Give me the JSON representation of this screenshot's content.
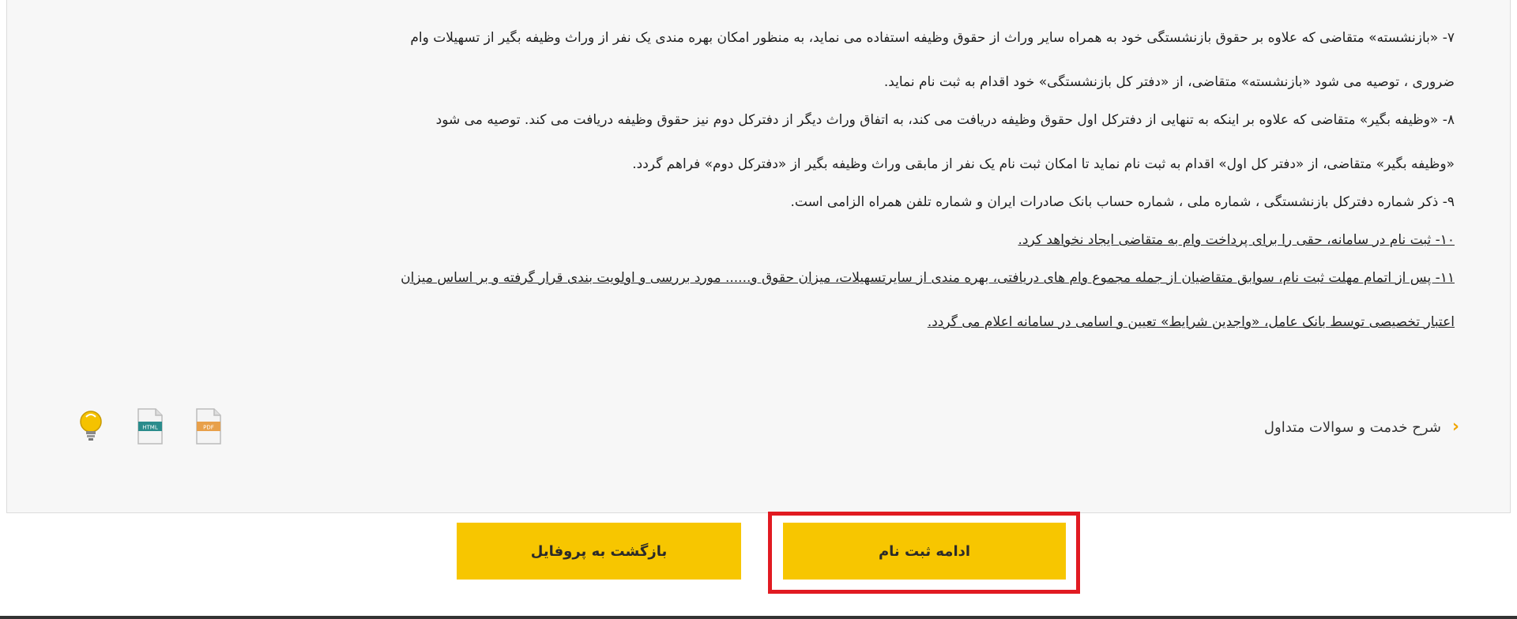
{
  "rules": {
    "r7_line1": "۷- «بازنشسته» متقاضی که علاوه بر حقوق بازنشستگی خود به همراه سایر وراث از حقوق وظیفه استفاده می نماید، به منظور امکان بهره مندی یک نفر از وراث وظیفه بگیر از تسهیلات وام",
    "r7_line2": "ضروری ، توصیه می شود «بازنشسته» متقاضی، از «دفتر کل بازنشستگی» خود اقدام به ثبت نام نماید.",
    "r8_line1": "۸- «وظیفه بگیر» متقاضی که علاوه بر اینکه به تنهایی از دفترکل اول حقوق وظیفه دریافت می کند، به اتفاق وراث دیگر از دفترکل دوم نیز حقوق وظیفه دریافت می کند. توصیه می شود",
    "r8_line2": "«وظیفه بگیر» متقاضی، از «دفتر کل اول» اقدام به ثبت نام نماید تا امکان ثبت نام یک نفر از مابقی وراث وظیفه بگیر از «دفترکل دوم» فراهم گردد.",
    "r9": "۹- ذکر شماره دفترکل بازنشستگی ، شماره ملی ، شماره حساب بانک صادرات ایران و شماره تلفن همراه الزامی است.",
    "r10": "۱۰- ثبت نام در سامانه، حقی را برای پرداخت وام به متقاضی ایجاد نخواهد کرد.",
    "r11_line1": "۱۱- پس از اتمام مهلت ثبت نام، سوابق متقاضیان از جمله مجموع وام های دریافتی، بهره مندی از سایرتسهیلات، میزان حقوق و...... مورد بررسی و اولویت بندی قرار گرفته و بر اساس میزان",
    "r11_line2": "اعتبار تخصیصی توسط بانک عامل، «واجدین شرایط» تعیین و اسامی در سامانه اعلام می گردد."
  },
  "faq": {
    "label": "شرح خدمت و سوالات متداول",
    "chevron_icon": "chevron-left-icon"
  },
  "file_icons": [
    {
      "name": "lightbulb-icon"
    },
    {
      "name": "html-file-icon",
      "label": "HTML"
    },
    {
      "name": "pdf-file-icon",
      "label": "PDF"
    }
  ],
  "buttons": {
    "back_label": "بازگشت به پروفایل",
    "continue_label": "ادامه ثبت نام"
  },
  "colors": {
    "button_bg": "#f7c600",
    "highlight_border": "#e11b22",
    "accent": "#f0a500",
    "panel_bg": "#f7f7f7"
  }
}
